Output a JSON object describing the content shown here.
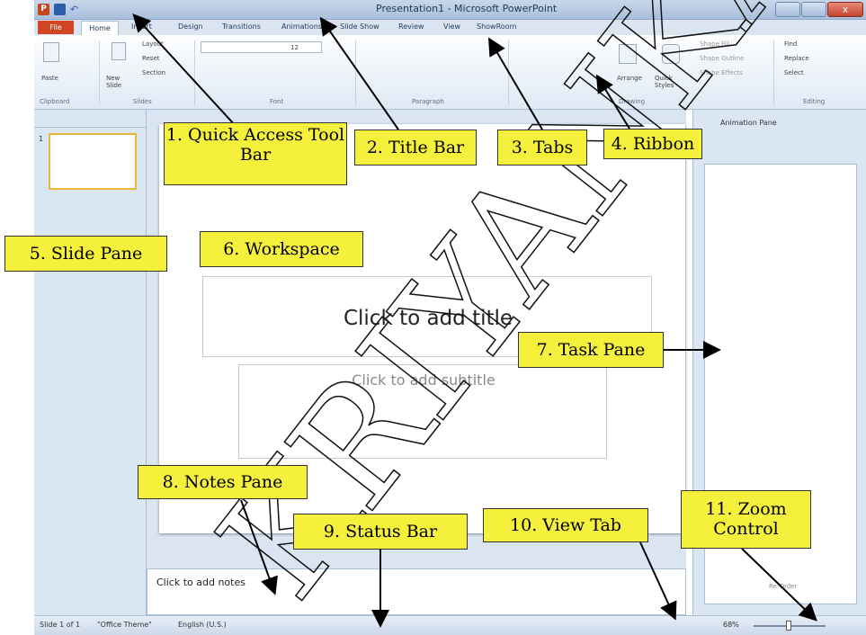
{
  "window": {
    "title": "Presentation1 - Microsoft PowerPoint",
    "close_glyph": "x"
  },
  "tabs": [
    "File",
    "Home",
    "Insert",
    "Design",
    "Transitions",
    "Animations",
    "Slide Show",
    "Review",
    "View",
    "ShowRoom"
  ],
  "ribbon": {
    "groups": [
      "Clipboard",
      "Slides",
      "Font",
      "Paragraph",
      "Drawing",
      "Editing"
    ],
    "items": {
      "paste": "Paste",
      "new_slide": "New Slide",
      "layout": "Layout",
      "reset": "Reset",
      "section": "Section",
      "font_size": "12",
      "arrange": "Arrange",
      "quick_styles": "Quick Styles",
      "shape_fill": "Shape Fill",
      "shape_outline": "Shape Outline",
      "shape_effects": "Shape Effects",
      "find": "Find",
      "replace": "Replace",
      "select": "Select"
    }
  },
  "slides_pane": {
    "slide_number": "1"
  },
  "slide": {
    "title_placeholder": "Click to add title",
    "subtitle_placeholder": "Click to add subtitle"
  },
  "notes": {
    "placeholder": "Click to add notes"
  },
  "task_pane": {
    "title": "Animation Pane",
    "reorder": "Re-Order"
  },
  "status_bar": {
    "slide_info": "Slide 1 of 1",
    "theme": "\"Office Theme\"",
    "language": "English (U.S.)",
    "zoom": "68%"
  },
  "callouts": {
    "quick_access": "1. Quick Access Tool Bar",
    "title_bar": "2. Title Bar",
    "tabs": "3. Tabs",
    "ribbon": "4. Ribbon",
    "slide_pane": "5. Slide Pane",
    "workspace": "6. Workspace",
    "task_pane": "7. Task Pane",
    "notes_pane": "8. Notes Pane",
    "status_bar": "9. Status Bar",
    "view_tab": "10. View Tab",
    "zoom_control": "11. Zoom Control"
  },
  "watermark": "KRIYANKA",
  "colors": {
    "callout_fill": "#f4f03c",
    "file_tab": "#d24625",
    "close_button": "#c1432c",
    "ribbon_bg": "#dfe9f5"
  }
}
